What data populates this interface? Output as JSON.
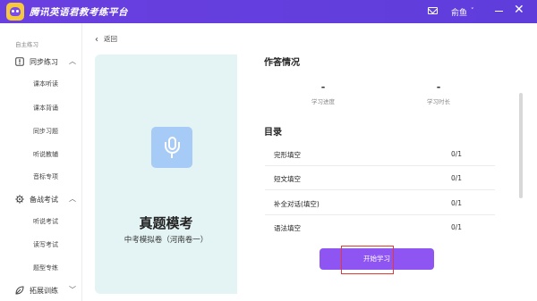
{
  "titlebar": {
    "app_title": "腾讯英语君教考练平台",
    "mail_icon": "mail-icon",
    "user_name": "俞鱼",
    "user_chevron": "˅",
    "minimize_icon": "minimize-icon",
    "close_glyph": "✕"
  },
  "sidebar": {
    "section_label": "自主练习",
    "groups": [
      {
        "label": "同步练习",
        "icon": "exclamation-box-icon",
        "items": [
          "课本听读",
          "课本背诵",
          "同步习题",
          "听说教辅",
          "音标专项"
        ]
      },
      {
        "label": "备战考试",
        "icon": "gear-icon",
        "items": [
          "听说考试",
          "读写考试",
          "题型专练"
        ]
      },
      {
        "label": "拓展训练",
        "icon": "leaf-icon",
        "items": []
      }
    ]
  },
  "main": {
    "back_label": "返回",
    "card": {
      "icon": "microphone-icon",
      "title": "真题模考",
      "subtitle": "中考模拟卷（河南卷一）"
    },
    "status": {
      "title": "作答情况",
      "progress_value": "-",
      "progress_label": "学习进度",
      "duration_value": "-",
      "duration_label": "学习时长"
    },
    "catalog": {
      "title": "目录",
      "rows": [
        {
          "name": "完形填空",
          "score": "0/1"
        },
        {
          "name": "短文填空",
          "score": "0/1"
        },
        {
          "name": "补全对话(填空)",
          "score": "0/1"
        },
        {
          "name": "语法填空",
          "score": "0/1"
        }
      ]
    },
    "start_button": "开始学习"
  },
  "colors": {
    "titlebar": "#6a3fe0",
    "accent_button": "#8f55f2",
    "card_bg": "#e4f4f4",
    "mic_tile": "#a7cbf7",
    "highlight": "#e53935"
  }
}
